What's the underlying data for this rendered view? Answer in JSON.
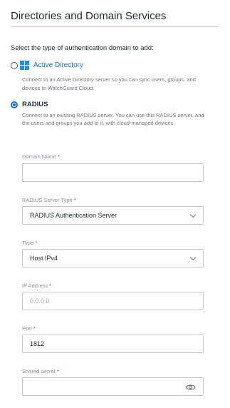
{
  "page_title": "Directories and Domain Services",
  "prompt": "Select the type of authentication domain to add:",
  "options": {
    "active_directory": {
      "label": "Active Directory",
      "description": "Connect to an Active Directory server so you can sync users, groups, and devices to WatchGuard Cloud.",
      "selected": false
    },
    "radius": {
      "label": "RADIUS",
      "description": "Connect to an existing RADIUS server. You can use this RADIUS server, and the users and groups you add to it, with cloud-managed devices.",
      "selected": true
    }
  },
  "form": {
    "domain_name": {
      "label": "Domain Name",
      "required": "*",
      "value": ""
    },
    "radius_server_type": {
      "label": "RADIUS Server Type",
      "required": "*",
      "value": "RADIUS Authentication Server"
    },
    "type": {
      "label": "Type",
      "required": "*",
      "value": "Host IPv4"
    },
    "ip_address": {
      "label": "IP Address",
      "required": "*",
      "placeholder": "0.0.0.0"
    },
    "port": {
      "label": "Port",
      "required": "*",
      "value": "1812"
    },
    "shared_secret": {
      "label": "Shared secret",
      "required": "*",
      "value": ""
    }
  },
  "colors": {
    "accent": "#1b6fd8",
    "required": "#d9363e",
    "windows_logo": "#1e90e6"
  },
  "icons": {
    "ad": "windows-logo-icon",
    "select": "chevron-down-icon",
    "reveal": "eye-icon"
  }
}
